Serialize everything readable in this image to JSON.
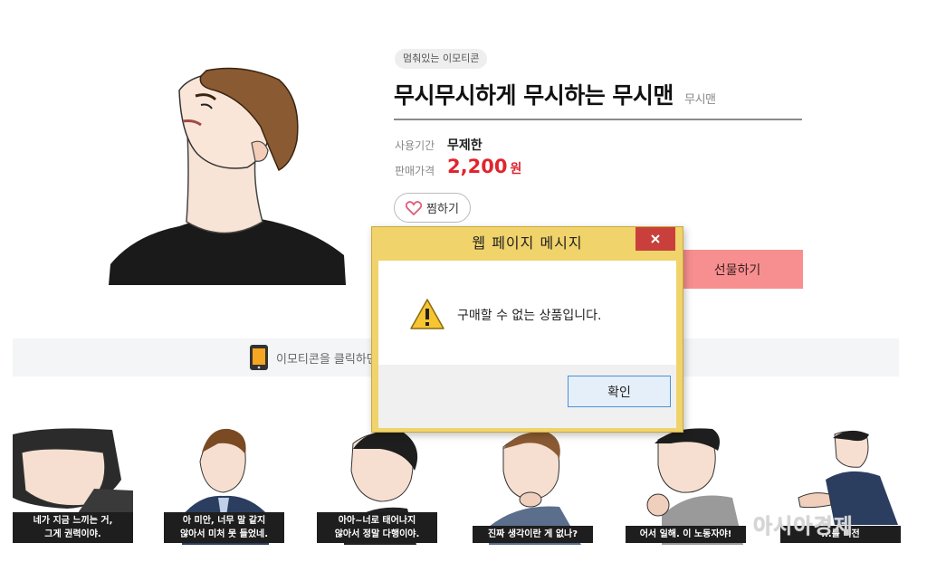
{
  "product": {
    "tag": "멈춰있는 이모티콘",
    "title": "무시무시하게 무시하는 무시맨",
    "author": "무시맨",
    "period_label": "사용기간",
    "period_value": "무제한",
    "price_label": "판매가격",
    "price_value": "2,200",
    "price_unit": "원",
    "wish_label": "찜하기",
    "gift_label": "선물하기"
  },
  "info_band": {
    "text": "이모티콘을 클릭하면"
  },
  "stickers": [
    {
      "caption": "네가 지금 느끼는 거,\n그게 권력이야."
    },
    {
      "caption": "아 미안, 너무 말 같지\n않아서 미처 못 들었네."
    },
    {
      "caption": "아아~너로 태어나지\n않아서 정말 다행이야."
    },
    {
      "caption": "진짜 생각이란 게 없나?"
    },
    {
      "caption": "어서 일해. 이 노동자야!"
    },
    {
      "caption": "...를 비전"
    }
  ],
  "dialog": {
    "title": "웹 페이지 메시지",
    "message": "구매할 수 없는 상품입니다.",
    "ok_label": "확인",
    "close_icon": "close-icon",
    "warning_icon": "warning-icon"
  },
  "watermark": "아시아경제",
  "colors": {
    "price": "#e0252f",
    "gift_button": "#f78f90",
    "dialog_frame": "#f1d36b",
    "close_button": "#c83f3b"
  }
}
